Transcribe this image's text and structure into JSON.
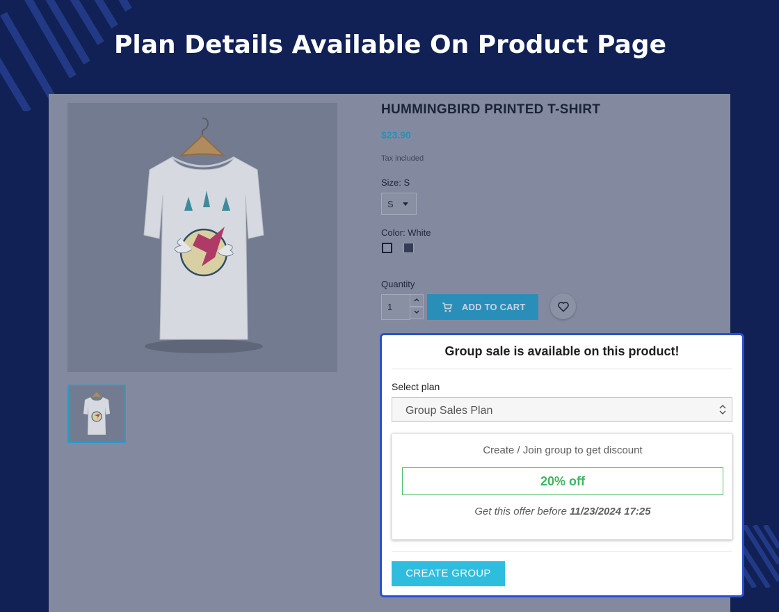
{
  "banner": {
    "title": "Plan Details Available On Product Page"
  },
  "product": {
    "title": "HUMMINGBIRD PRINTED T-SHIRT",
    "price": "$23.90",
    "tax_note": "Tax included",
    "size_label": "Size: S",
    "size_selected": "S",
    "color_label": "Color: White",
    "quantity_label": "Quantity",
    "quantity_value": "1",
    "add_to_cart_label": "ADD TO CART"
  },
  "group_sale": {
    "title": "Group sale is available on this product!",
    "select_plan_label": "Select plan",
    "selected_plan": "Group Sales Plan",
    "card_heading": "Create / Join group to get discount",
    "discount": "20% off",
    "offer_prefix": "Get this offer before",
    "offer_deadline": "11/23/2024 17:25",
    "create_button": "CREATE GROUP"
  },
  "colors": {
    "background": "#112156",
    "overlay": "#838a9f",
    "panel_border": "#2b4fd0",
    "accent_blue": "#2a8fb8",
    "create_button": "#2fbddd",
    "discount_green": "#3fb560"
  }
}
